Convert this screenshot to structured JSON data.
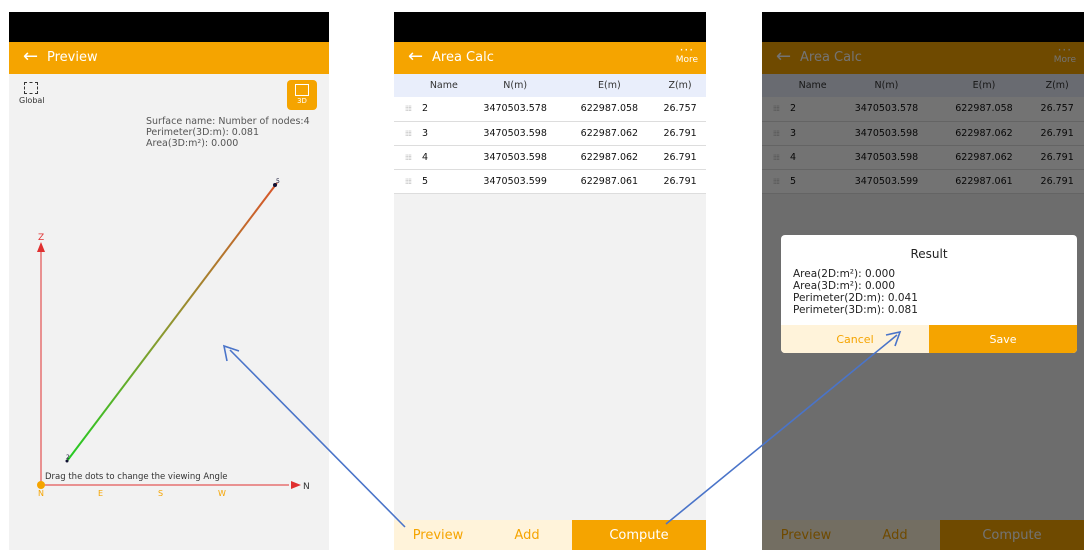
{
  "preview": {
    "title": "Preview",
    "global_label": "Global",
    "btn3d_label": "3D",
    "surface_name": "Surface name:  Number of nodes:4",
    "perimeter": "Perimeter(3D:m): 0.081",
    "area": "Area(3D:m²): 0.000",
    "hint": "Drag the dots to change the viewing Angle",
    "axis_z": "Z",
    "axis_n": "N",
    "compass": [
      "N",
      "E",
      "S",
      "W"
    ],
    "point_top": "5",
    "point_bottom": "2"
  },
  "area_calc": {
    "title": "Area Calc",
    "more_label": "More",
    "columns": [
      "Name",
      "N(m)",
      "E(m)",
      "Z(m)"
    ],
    "rows": [
      {
        "name": "2",
        "n": "3470503.578",
        "e": "622987.058",
        "z": "26.757"
      },
      {
        "name": "3",
        "n": "3470503.598",
        "e": "622987.062",
        "z": "26.791"
      },
      {
        "name": "4",
        "n": "3470503.598",
        "e": "622987.062",
        "z": "26.791"
      },
      {
        "name": "5",
        "n": "3470503.599",
        "e": "622987.061",
        "z": "26.791"
      }
    ],
    "bottom": {
      "preview": "Preview",
      "add": "Add",
      "compute": "Compute"
    }
  },
  "result": {
    "title": "Result",
    "area2d": "Area(2D:m²): 0.000",
    "area3d": "Area(3D:m²): 0.000",
    "perim2d": "Perimeter(2D:m): 0.041",
    "perim3d": "Perimeter(3D:m): 0.081",
    "cancel": "Cancel",
    "save": "Save"
  },
  "colors": {
    "accent": "#f5a400",
    "axis": "#e03030",
    "arrow": "#4a74c9"
  }
}
